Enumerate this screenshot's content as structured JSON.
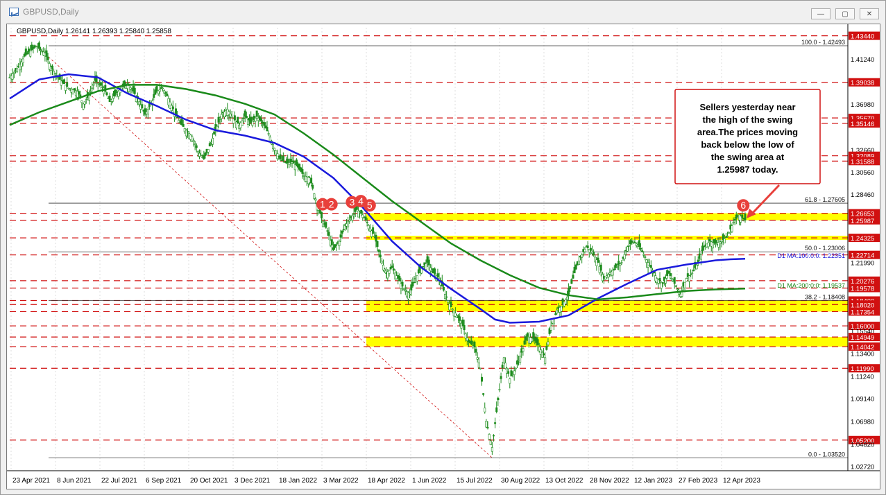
{
  "window": {
    "title": "GBPUSD,Daily",
    "symbol_info": "GBPUSD,Daily  1.26141 1.26393 1.25840 1.25858",
    "minimize_label": "—",
    "maximize_label": "▢",
    "close_label": "✕"
  },
  "chart_data": {
    "type": "candlestick",
    "symbol": "GBPUSD",
    "timeframe": "Daily",
    "ohlc_last": {
      "open": 1.26141,
      "high": 1.26393,
      "low": 1.2584,
      "close": 1.25858
    },
    "y_range": [
      1.023,
      1.442
    ],
    "price_ticks": [
      "1.43440",
      "1.41240",
      "1.39038",
      "1.36980",
      "1.35670",
      "1.35146",
      "1.32660",
      "1.32089",
      "1.31588",
      "1.30560",
      "1.28460",
      "1.26653",
      "1.25987",
      "1.24325",
      "1.22714",
      "1.21990",
      "1.20276",
      "1.19578",
      "1.18400",
      "1.18020",
      "1.17354",
      "1.16000",
      "1.15540",
      "1.14949",
      "1.14042",
      "1.13400",
      "1.11990",
      "1.11240",
      "1.09140",
      "1.06980",
      "1.05200",
      "1.04820",
      "1.02720"
    ],
    "date_ticks": [
      "23 Apr 2021",
      "8 Jun 2021",
      "22 Jul 2021",
      "6 Sep 2021",
      "20 Oct 2021",
      "3 Dec 2021",
      "18 Jan 2022",
      "3 Mar 2022",
      "18 Apr 2022",
      "1 Jun 2022",
      "15 Jul 2022",
      "30 Aug 2022",
      "13 Oct 2022",
      "28 Nov 2022",
      "12 Jan 2023",
      "27 Feb 2023",
      "12 Apr 2023"
    ],
    "price_path": [
      [
        0,
        1.395
      ],
      [
        3,
        1.405
      ],
      [
        5,
        1.415
      ],
      [
        7,
        1.42
      ],
      [
        9,
        1.4245
      ],
      [
        12,
        1.418
      ],
      [
        14,
        1.405
      ],
      [
        17,
        1.393
      ],
      [
        20,
        1.385
      ],
      [
        23,
        1.382
      ],
      [
        25,
        1.37
      ],
      [
        27,
        1.378
      ],
      [
        29,
        1.392
      ],
      [
        32,
        1.385
      ],
      [
        34,
        1.372
      ],
      [
        36,
        1.379
      ],
      [
        38,
        1.385
      ],
      [
        40,
        1.389
      ],
      [
        42,
        1.382
      ],
      [
        44,
        1.372
      ],
      [
        46,
        1.36
      ],
      [
        48,
        1.37
      ],
      [
        50,
        1.382
      ],
      [
        52,
        1.385
      ],
      [
        54,
        1.375
      ],
      [
        56,
        1.362
      ],
      [
        58,
        1.352
      ],
      [
        60,
        1.345
      ],
      [
        62,
        1.339
      ],
      [
        64,
        1.325
      ],
      [
        66,
        1.318
      ],
      [
        68,
        1.33
      ],
      [
        70,
        1.345
      ],
      [
        72,
        1.36
      ],
      [
        74,
        1.365
      ],
      [
        76,
        1.356
      ],
      [
        78,
        1.35
      ],
      [
        80,
        1.358
      ],
      [
        82,
        1.352
      ],
      [
        84,
        1.358
      ],
      [
        86,
        1.352
      ],
      [
        88,
        1.342
      ],
      [
        90,
        1.328
      ],
      [
        92,
        1.318
      ],
      [
        94,
        1.314
      ],
      [
        96,
        1.315
      ],
      [
        98,
        1.31
      ],
      [
        100,
        1.302
      ],
      [
        102,
        1.3
      ],
      [
        104,
        1.28
      ],
      [
        106,
        1.262
      ],
      [
        108,
        1.25
      ],
      [
        110,
        1.232
      ],
      [
        112,
        1.24
      ],
      [
        114,
        1.255
      ],
      [
        116,
        1.262
      ],
      [
        118,
        1.27
      ],
      [
        120,
        1.265
      ],
      [
        122,
        1.255
      ],
      [
        124,
        1.245
      ],
      [
        126,
        1.225
      ],
      [
        128,
        1.21
      ],
      [
        130,
        1.215
      ],
      [
        132,
        1.205
      ],
      [
        134,
        1.195
      ],
      [
        136,
        1.19
      ],
      [
        138,
        1.205
      ],
      [
        140,
        1.215
      ],
      [
        142,
        1.22
      ],
      [
        144,
        1.21
      ],
      [
        146,
        1.205
      ],
      [
        148,
        1.19
      ],
      [
        150,
        1.178
      ],
      [
        152,
        1.17
      ],
      [
        154,
        1.16
      ],
      [
        156,
        1.145
      ],
      [
        158,
        1.14
      ],
      [
        160,
        1.12
      ],
      [
        162,
        1.07
      ],
      [
        164,
        1.045
      ],
      [
        166,
        1.09
      ],
      [
        168,
        1.13
      ],
      [
        170,
        1.11
      ],
      [
        172,
        1.12
      ],
      [
        174,
        1.135
      ],
      [
        176,
        1.15
      ],
      [
        178,
        1.148
      ],
      [
        180,
        1.14
      ],
      [
        182,
        1.13
      ],
      [
        184,
        1.16
      ],
      [
        186,
        1.175
      ],
      [
        188,
        1.18
      ],
      [
        190,
        1.19
      ],
      [
        192,
        1.21
      ],
      [
        194,
        1.225
      ],
      [
        196,
        1.235
      ],
      [
        198,
        1.23
      ],
      [
        200,
        1.22
      ],
      [
        202,
        1.205
      ],
      [
        204,
        1.21
      ],
      [
        206,
        1.215
      ],
      [
        208,
        1.22
      ],
      [
        210,
        1.235
      ],
      [
        212,
        1.24
      ],
      [
        214,
        1.235
      ],
      [
        216,
        1.225
      ],
      [
        218,
        1.215
      ],
      [
        220,
        1.205
      ],
      [
        222,
        1.2
      ],
      [
        224,
        1.21
      ],
      [
        226,
        1.2
      ],
      [
        228,
        1.19
      ],
      [
        230,
        1.205
      ],
      [
        232,
        1.21
      ],
      [
        234,
        1.22
      ],
      [
        236,
        1.235
      ],
      [
        238,
        1.24
      ],
      [
        240,
        1.238
      ],
      [
        242,
        1.24
      ],
      [
        244,
        1.245
      ],
      [
        246,
        1.258
      ],
      [
        248,
        1.265
      ],
      [
        250,
        1.26
      ]
    ],
    "ma100_path": [
      [
        0,
        1.375
      ],
      [
        10,
        1.393
      ],
      [
        20,
        1.398
      ],
      [
        30,
        1.395
      ],
      [
        40,
        1.38
      ],
      [
        50,
        1.368
      ],
      [
        60,
        1.355
      ],
      [
        70,
        1.345
      ],
      [
        80,
        1.34
      ],
      [
        90,
        1.333
      ],
      [
        100,
        1.32
      ],
      [
        110,
        1.3
      ],
      [
        120,
        1.272
      ],
      [
        130,
        1.24
      ],
      [
        140,
        1.215
      ],
      [
        150,
        1.195
      ],
      [
        160,
        1.176
      ],
      [
        165,
        1.166
      ],
      [
        170,
        1.163
      ],
      [
        180,
        1.164
      ],
      [
        190,
        1.17
      ],
      [
        200,
        1.186
      ],
      [
        210,
        1.2
      ],
      [
        220,
        1.213
      ],
      [
        230,
        1.218
      ],
      [
        240,
        1.222
      ],
      [
        245,
        1.223
      ],
      [
        250,
        1.2235
      ]
    ],
    "ma200_path": [
      [
        0,
        1.35
      ],
      [
        10,
        1.362
      ],
      [
        20,
        1.372
      ],
      [
        30,
        1.382
      ],
      [
        40,
        1.388
      ],
      [
        50,
        1.388
      ],
      [
        60,
        1.384
      ],
      [
        70,
        1.378
      ],
      [
        80,
        1.37
      ],
      [
        90,
        1.36
      ],
      [
        100,
        1.342
      ],
      [
        110,
        1.322
      ],
      [
        120,
        1.3
      ],
      [
        130,
        1.278
      ],
      [
        140,
        1.258
      ],
      [
        150,
        1.238
      ],
      [
        160,
        1.222
      ],
      [
        170,
        1.208
      ],
      [
        180,
        1.196
      ],
      [
        190,
        1.189
      ],
      [
        200,
        1.185
      ],
      [
        210,
        1.187
      ],
      [
        220,
        1.19
      ],
      [
        230,
        1.193
      ],
      [
        240,
        1.1945
      ],
      [
        250,
        1.1953
      ]
    ],
    "swing_labels": [
      {
        "label": "1",
        "x": 104,
        "y": 1.275
      },
      {
        "label": "2",
        "x": 107,
        "y": 1.275
      },
      {
        "label": "3",
        "x": 114,
        "y": 1.277
      },
      {
        "label": "4",
        "x": 117,
        "y": 1.278
      },
      {
        "label": "5",
        "x": 120,
        "y": 1.274
      },
      {
        "label": "6",
        "x": 247,
        "y": 1.274
      }
    ],
    "fib_levels": [
      {
        "label": "100.0 - 1.42493",
        "value": 1.42493
      },
      {
        "label": "61.8 - 1.27605",
        "value": 1.27605
      },
      {
        "label": "50.0 - 1.23006",
        "value": 1.23006
      },
      {
        "label": "38.2 - 1.18408",
        "value": 1.18408
      },
      {
        "label": "0.0 - 1.03520",
        "value": 1.0352
      }
    ],
    "ma_labels": [
      {
        "label": "D1 MA:100:0:0: 1.22351",
        "value": 1.22351
      },
      {
        "label": "D1 MA:200:0:0: 1.19537",
        "value": 1.19537
      }
    ],
    "red_levels": [
      1.4344,
      1.39038,
      1.3567,
      1.35146,
      1.32089,
      1.31588,
      1.26653,
      1.25987,
      1.24325,
      1.22714,
      1.20276,
      1.19578,
      1.184,
      1.1802,
      1.17354,
      1.16,
      1.14949,
      1.14042,
      1.1199,
      1.052
    ],
    "yellow_zones": [
      [
        1.25987,
        1.26653
      ],
      [
        1.24325,
        1.24325
      ],
      [
        1.17354,
        1.184
      ],
      [
        1.14042,
        1.14949
      ]
    ],
    "annotation": "Sellers yesterday near the high of the swing area.The prices moving back below the low of the swing area at 1.25987 today.",
    "colors": {
      "ma100": "#1a1adc",
      "ma200": "#1a8a1a",
      "candles": "#1e8c1e",
      "levels": "#d11010",
      "zone": "#ffff00",
      "label_bg": "#e8403b"
    }
  }
}
